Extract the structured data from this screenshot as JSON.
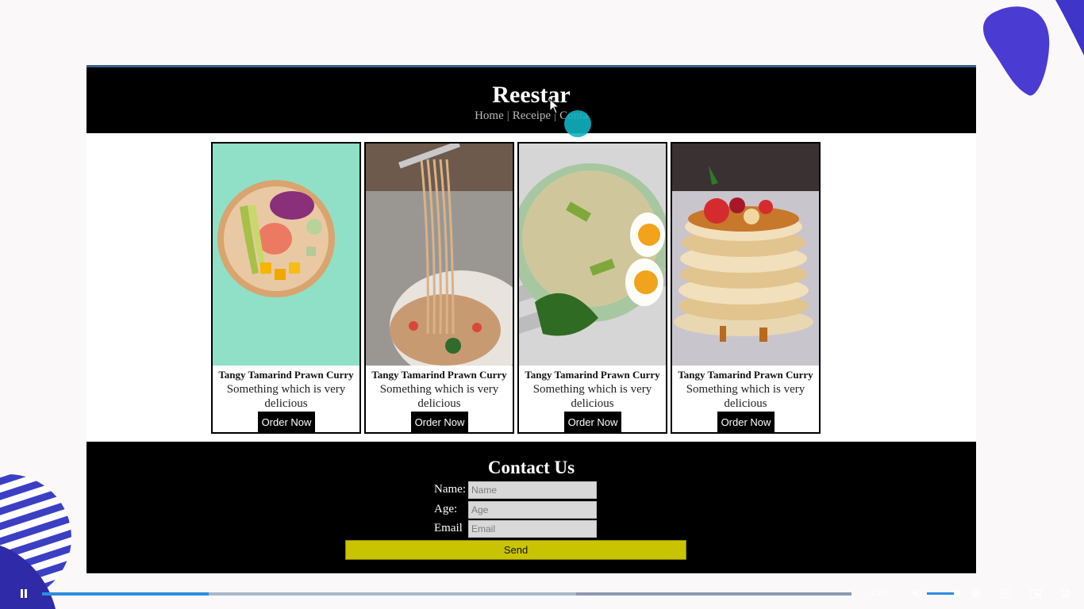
{
  "site": {
    "brand": "Reestar",
    "nav": {
      "home": "Home",
      "receipe": "Receipe",
      "contact": "Conta",
      "separator": "|"
    }
  },
  "cards": [
    {
      "title": "Tangy Tamarind Prawn Curry",
      "description": "Something which is very delicious",
      "button": "Order Now",
      "image": "salmon-poke-bowl"
    },
    {
      "title": "Tangy Tamarind Prawn Curry",
      "description": "Something which is very delicious",
      "button": "Order Now",
      "image": "spaghetti-fork"
    },
    {
      "title": "Tangy Tamarind Prawn Curry",
      "description": "Something which is very delicious",
      "button": "Order Now",
      "image": "rice-egg-bowl"
    },
    {
      "title": "Tangy Tamarind Prawn Curry",
      "description": "Something which is very delicious",
      "button": "Order Now",
      "image": "pancake-stack"
    }
  ],
  "contact": {
    "title": "Contact Us",
    "fields": [
      {
        "label": "Name:",
        "placeholder": "Name"
      },
      {
        "label": "Age:",
        "placeholder": "Age"
      },
      {
        "label": "Email",
        "placeholder": "Email"
      }
    ],
    "send": "Send"
  },
  "player": {
    "time_remaining": "-1:34",
    "progress_fraction": 0.206,
    "buffered_fraction": 0.66,
    "volume_fraction": 0.9,
    "icons": [
      "pause-icon",
      "volume-icon",
      "settings-icon",
      "hd-icon",
      "picture-in-picture-icon",
      "exit-fullscreen-icon"
    ]
  },
  "colors": {
    "header_bg": "#000000",
    "send_button": "#c9c400",
    "progress": "#2d8de0",
    "cursor_highlight": "#0fb3c0",
    "accent_blob": "#4b3fd6"
  }
}
